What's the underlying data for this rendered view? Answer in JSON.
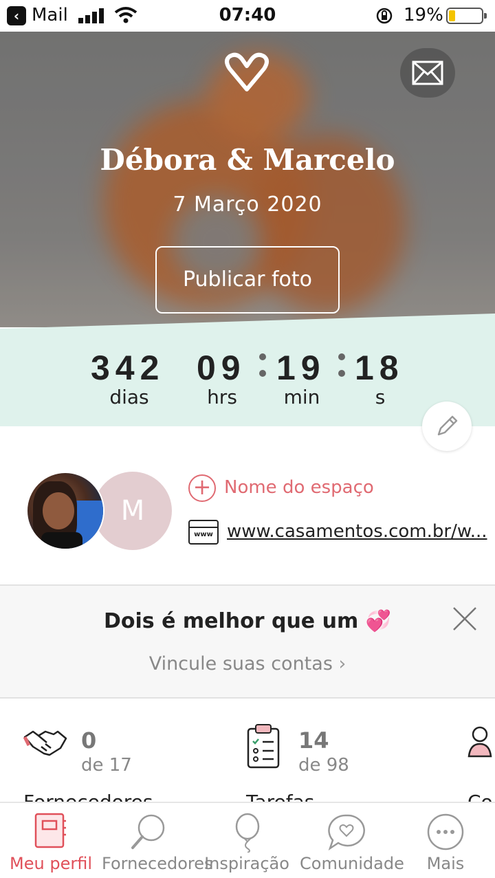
{
  "status_bar": {
    "back_app": "Mail",
    "time": "07:40",
    "battery": "19%",
    "battery_level": 0.19
  },
  "hero": {
    "logo_icon": "heart-icon",
    "mail_icon": "mail-icon",
    "couple_names": "Débora & Marcelo",
    "wedding_date": "7 Março 2020",
    "publish_button": "Publicar foto"
  },
  "countdown": {
    "days": "342",
    "days_label": "dias",
    "hours": "09",
    "hours_label": "hrs",
    "minutes": "19",
    "minutes_label": "min",
    "seconds": "18",
    "seconds_label": "s"
  },
  "profile": {
    "partner_initial": "M",
    "space_name_action": "Nome do espaço",
    "website_url": "www.casamentos.com.br/w..."
  },
  "banner": {
    "title": "Dois é melhor que um 💞",
    "subtitle": "Vincule suas contas",
    "close_icon": "close-icon"
  },
  "stats": [
    {
      "value": "0",
      "of": "de 17",
      "name": "Fornecedores",
      "icon": "handshake-icon"
    },
    {
      "value": "14",
      "of": "de 98",
      "name": "Tarefas",
      "icon": "clipboard-checklist-icon"
    },
    {
      "value": "",
      "of": "",
      "name": "Co",
      "icon": "guests-icon"
    }
  ],
  "tabs": [
    {
      "label": "Meu perfil",
      "icon": "notebook-icon",
      "active": true
    },
    {
      "label": "Fornecedores",
      "icon": "magnifier-icon",
      "active": false
    },
    {
      "label": "Inspiração",
      "icon": "balloon-icon",
      "active": false
    },
    {
      "label": "Comunidade",
      "icon": "chat-heart-icon",
      "active": false
    },
    {
      "label": "Mais",
      "icon": "more-icon",
      "active": false
    }
  ],
  "colors": {
    "accent": "#e0505a",
    "countdown_bg": "#dff2ec",
    "partner_avatar": "#e3cdd0"
  }
}
